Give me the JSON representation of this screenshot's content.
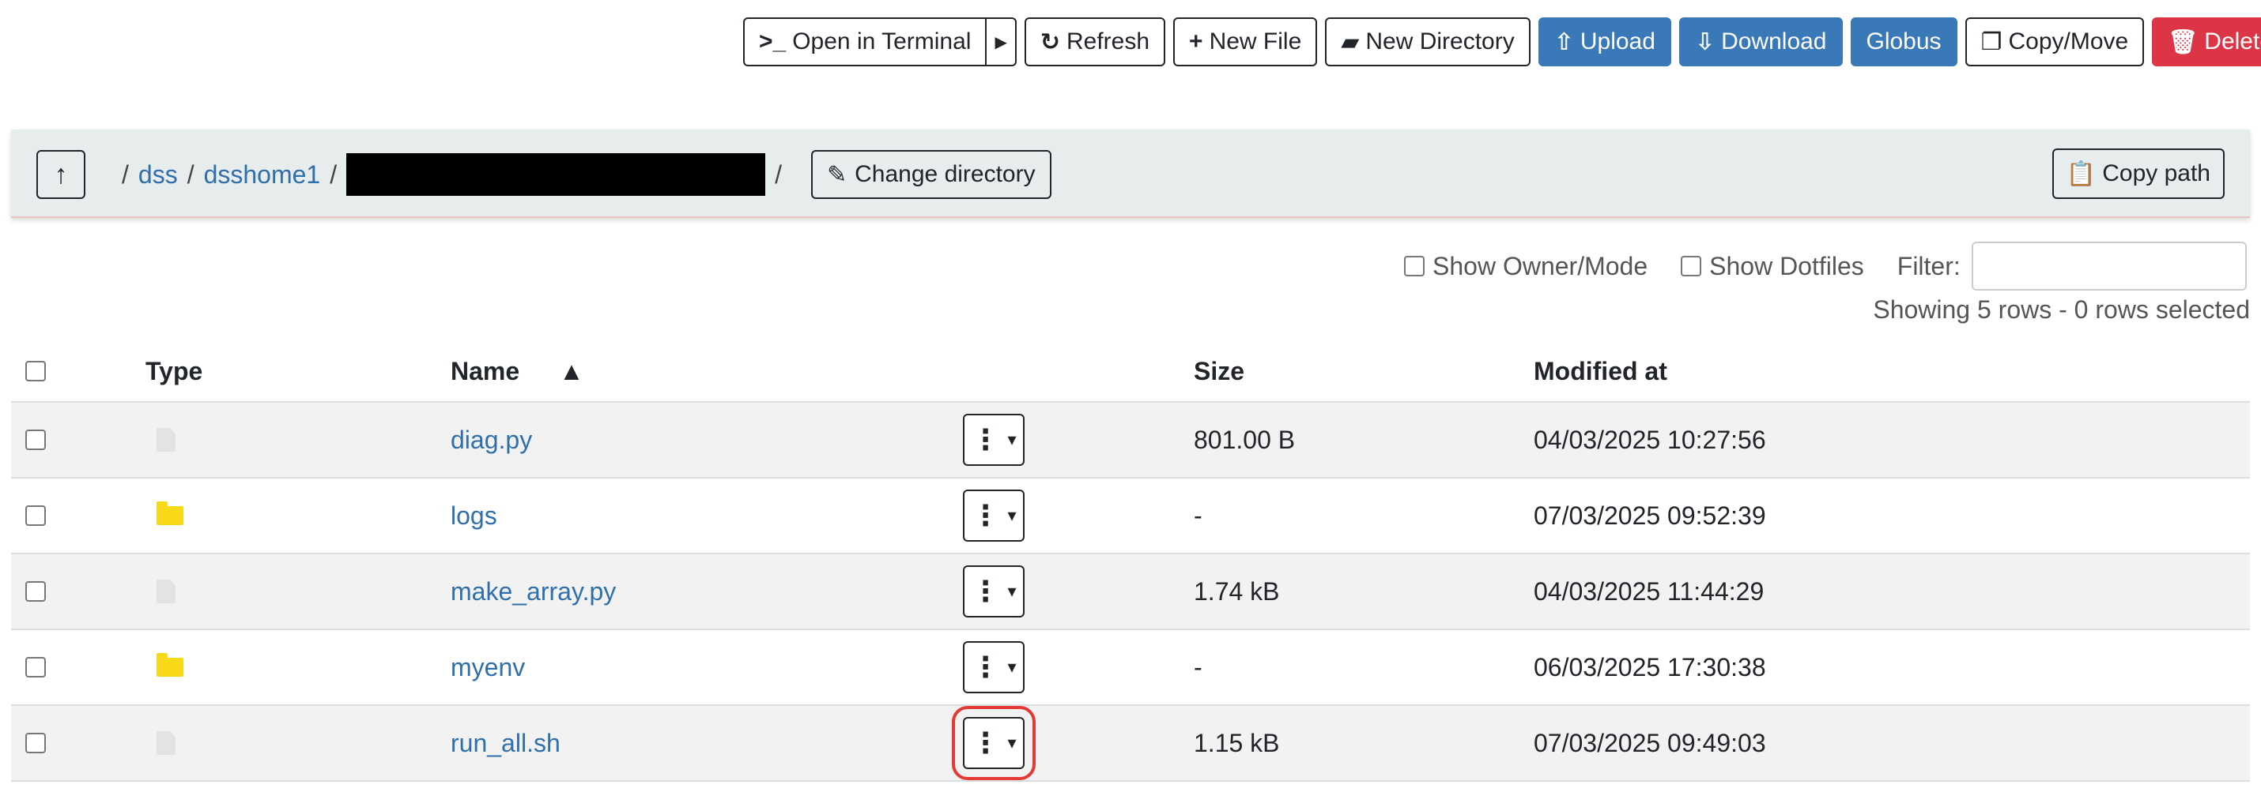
{
  "toolbar": {
    "open_terminal": "Open in Terminal",
    "refresh": "Refresh",
    "new_file": "New File",
    "new_directory": "New Directory",
    "upload": "Upload",
    "download": "Download",
    "globus": "Globus",
    "copy_move": "Copy/Move",
    "delete": "Delete"
  },
  "path": {
    "leading_sep": "/",
    "crumbs": [
      "dss",
      "dsshome1"
    ],
    "sep": "/",
    "trailing_sep": "/",
    "change_directory": "Change directory",
    "copy_path": "Copy path"
  },
  "options": {
    "show_owner_mode": "Show Owner/Mode",
    "show_dotfiles": "Show Dotfiles",
    "filter_label": "Filter:",
    "showing": "Showing 5 rows - 0 rows selected"
  },
  "table": {
    "headers": {
      "type": "Type",
      "name": "Name",
      "size": "Size",
      "modified": "Modified at"
    },
    "sort_indicator": "▲",
    "rows": [
      {
        "type": "file",
        "name": "diag.py",
        "size": "801.00 B",
        "modified": "04/03/2025 10:27:56"
      },
      {
        "type": "folder",
        "name": "logs",
        "size": "-",
        "modified": "07/03/2025 09:52:39"
      },
      {
        "type": "file",
        "name": "make_array.py",
        "size": "1.74 kB",
        "modified": "04/03/2025 11:44:29"
      },
      {
        "type": "folder",
        "name": "myenv",
        "size": "-",
        "modified": "06/03/2025 17:30:38"
      },
      {
        "type": "file",
        "name": "run_all.sh",
        "size": "1.15 kB",
        "modified": "07/03/2025 09:49:03"
      }
    ]
  },
  "colors": {
    "primary": "#3a79b7",
    "danger": "#dc3545",
    "highlight": "#e53935",
    "folder": "#f7d917"
  }
}
